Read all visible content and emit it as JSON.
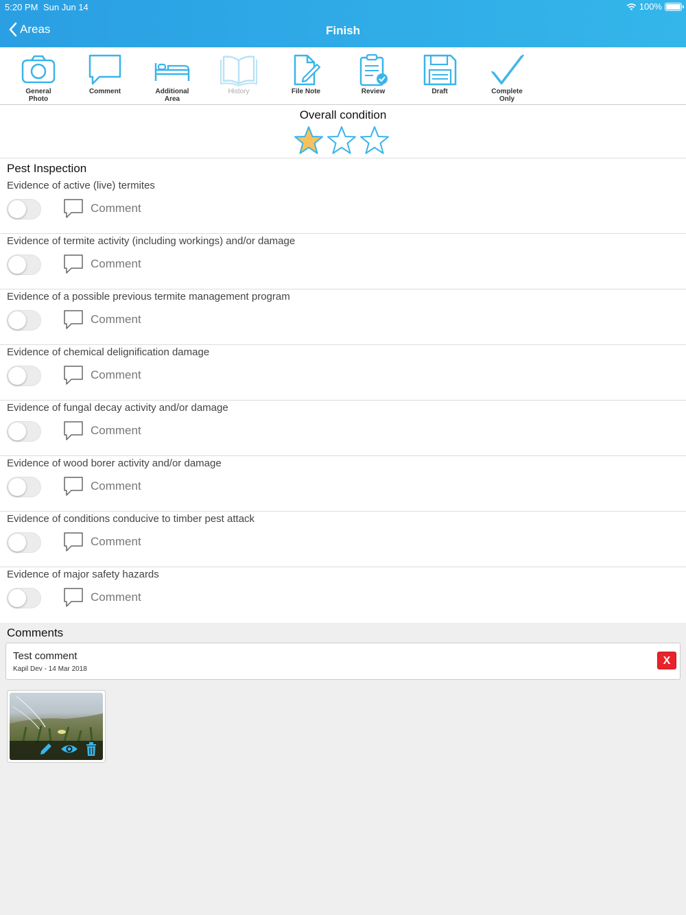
{
  "status_bar": {
    "time": "5:20 PM",
    "date": "Sun Jun 14",
    "battery": "100%"
  },
  "nav": {
    "back_label": "Areas",
    "title": "Finish"
  },
  "toolbar": [
    {
      "label": "General\nPhoto",
      "icon": "camera-icon",
      "enabled": true
    },
    {
      "label": "Comment",
      "icon": "speech-bubble-icon",
      "enabled": true
    },
    {
      "label": "Additional\nArea",
      "icon": "bed-icon",
      "enabled": true
    },
    {
      "label": "History",
      "icon": "book-icon",
      "enabled": false
    },
    {
      "label": "File Note",
      "icon": "file-edit-icon",
      "enabled": true
    },
    {
      "label": "Review",
      "icon": "clipboard-check-icon",
      "enabled": true
    },
    {
      "label": "Draft",
      "icon": "floppy-disk-icon",
      "enabled": true
    },
    {
      "label": "Complete\nOnly",
      "icon": "checkmark-icon",
      "enabled": true
    }
  ],
  "condition": {
    "title": "Overall condition",
    "rating": 1,
    "max_rating": 3
  },
  "section": {
    "title": "Pest Inspection",
    "comment_label": "Comment",
    "items": [
      {
        "label": "Evidence of active (live) termites",
        "checked": false
      },
      {
        "label": "Evidence of termite activity (including workings) and/or damage",
        "checked": false
      },
      {
        "label": "Evidence of a possible previous termite management program",
        "checked": false
      },
      {
        "label": "Evidence of chemical delignification damage",
        "checked": false
      },
      {
        "label": "Evidence of fungal decay activity and/or damage",
        "checked": false
      },
      {
        "label": "Evidence of wood borer activity and/or damage",
        "checked": false
      },
      {
        "label": "Evidence of conditions conducive to timber pest attack",
        "checked": false
      },
      {
        "label": "Evidence of major safety hazards",
        "checked": false
      }
    ]
  },
  "comments": {
    "title": "Comments",
    "entries": [
      {
        "text": "Test comment",
        "meta": "Kapil Dev - 14 Mar 2018",
        "delete_label": "X"
      }
    ]
  },
  "colors": {
    "accent": "#3ab4ea",
    "star_filled": "#f8c15c",
    "delete": "#e8232c"
  }
}
